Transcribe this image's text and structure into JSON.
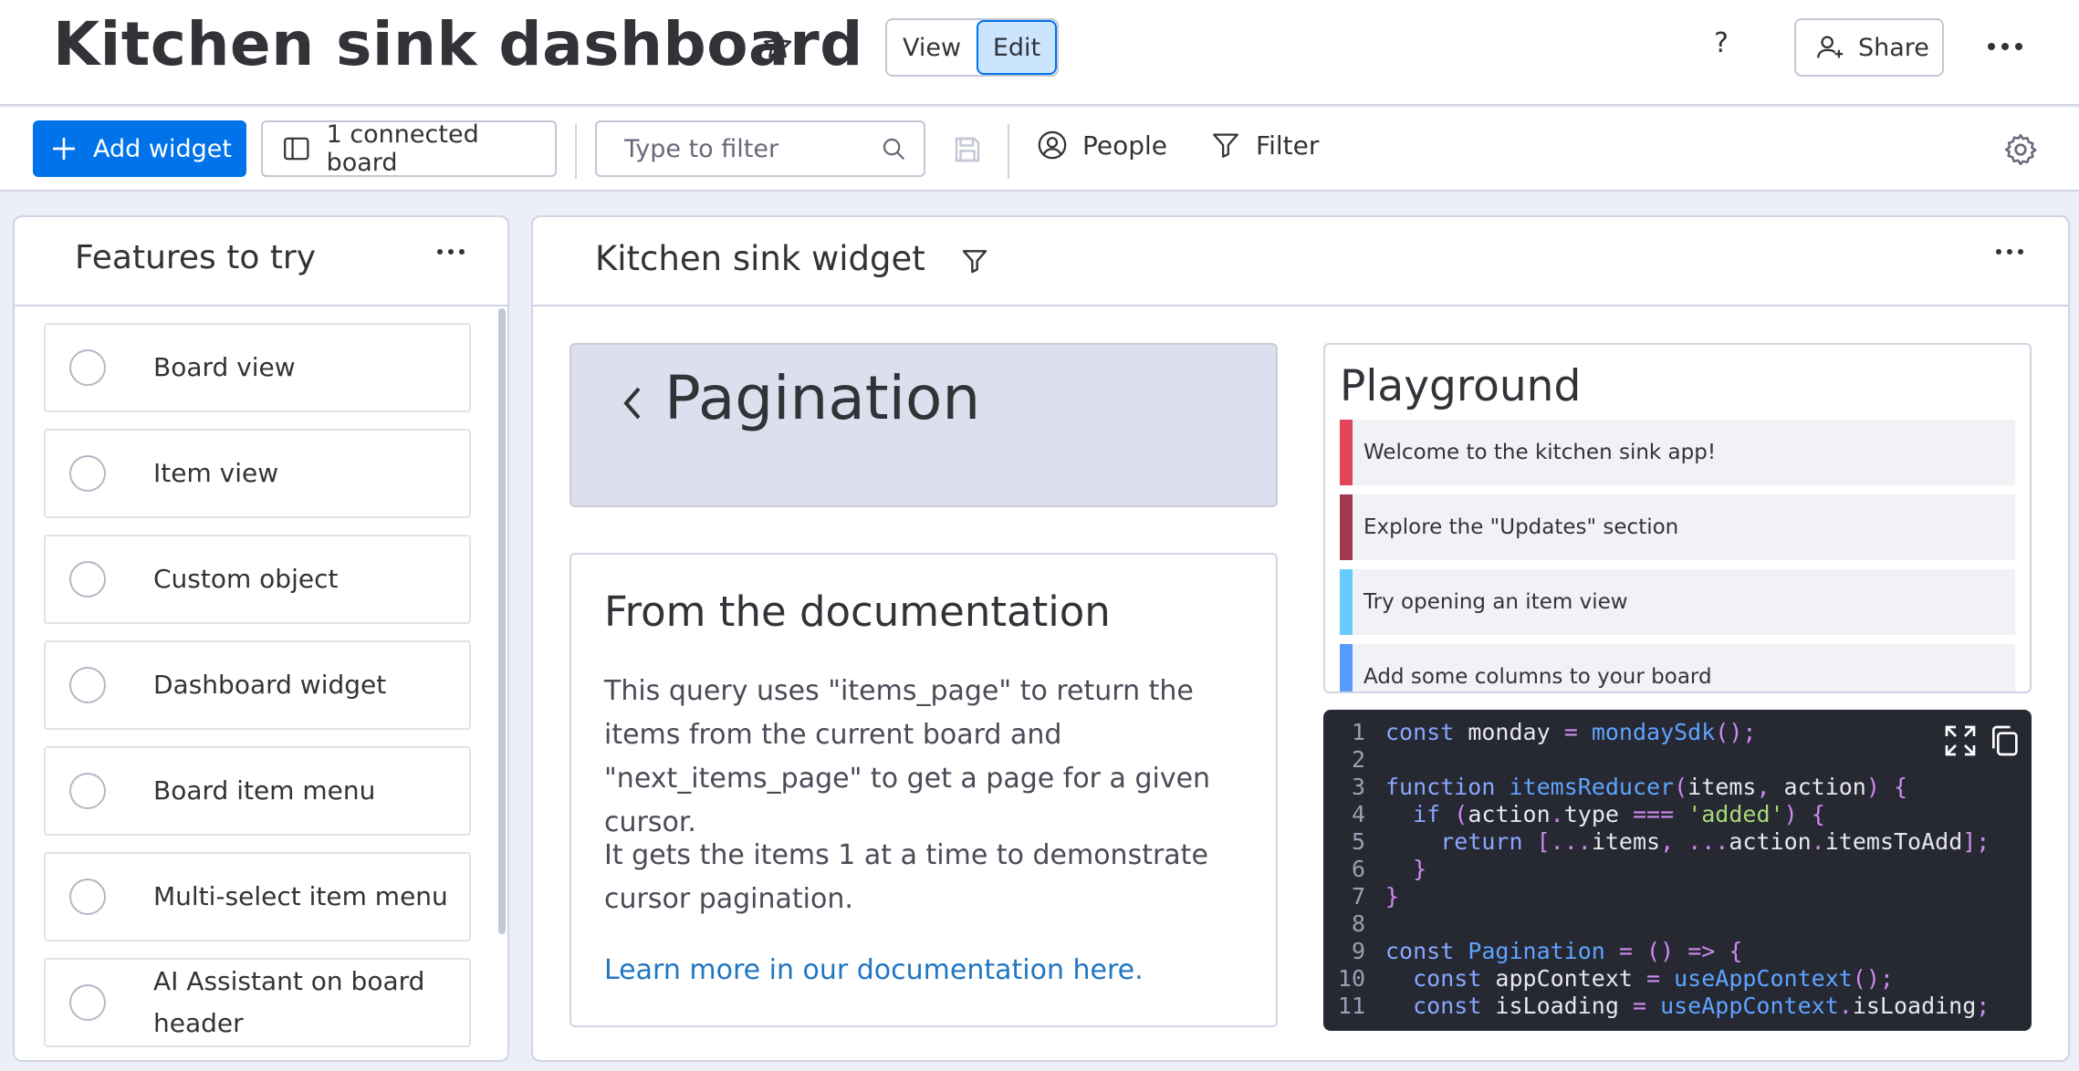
{
  "header": {
    "title": "Kitchen sink dashboard",
    "view_label": "View",
    "edit_label": "Edit",
    "help_label": "?",
    "share_label": "Share"
  },
  "toolbar": {
    "add_widget_label": "Add widget",
    "connected_board_label": "1 connected board",
    "filter_placeholder": "Type to filter",
    "people_label": "People",
    "filter_label": "Filter"
  },
  "features_panel": {
    "title": "Features to try",
    "items": [
      {
        "label": "Board view"
      },
      {
        "label": "Item view"
      },
      {
        "label": "Custom object"
      },
      {
        "label": "Dashboard widget"
      },
      {
        "label": "Board item menu"
      },
      {
        "label": "Multi-select item menu"
      },
      {
        "label": "AI Assistant on board header"
      }
    ]
  },
  "widget": {
    "title": "Kitchen sink widget",
    "pagination_title": "Pagination",
    "doc": {
      "title": "From the documentation",
      "paragraph1": "This query uses \"items_page\" to return the items from the current board and \"next_items_page\" to get a page for a given cursor.",
      "paragraph2": "It gets the items 1 at a time to demonstrate cursor pagination.",
      "link": "Learn more in our documentation here."
    },
    "playground": {
      "title": "Playground",
      "messages": [
        {
          "text": "Welcome to the kitchen sink app!",
          "color": "#e2445c"
        },
        {
          "text": "Explore the \"Updates\" section",
          "color": "#a1384f"
        },
        {
          "text": "Try opening an item view",
          "color": "#66ccff"
        },
        {
          "text": "Add some columns to your board",
          "color": "#579bfc"
        }
      ]
    },
    "code": {
      "line_numbers": [
        "1",
        "2",
        "3",
        "4",
        "5",
        "6",
        "7",
        "8",
        "9",
        "10",
        "11"
      ]
    }
  },
  "colors": {
    "accent": "#0073ea",
    "edit_bg": "#cce5ff",
    "code_bg": "#262832"
  }
}
